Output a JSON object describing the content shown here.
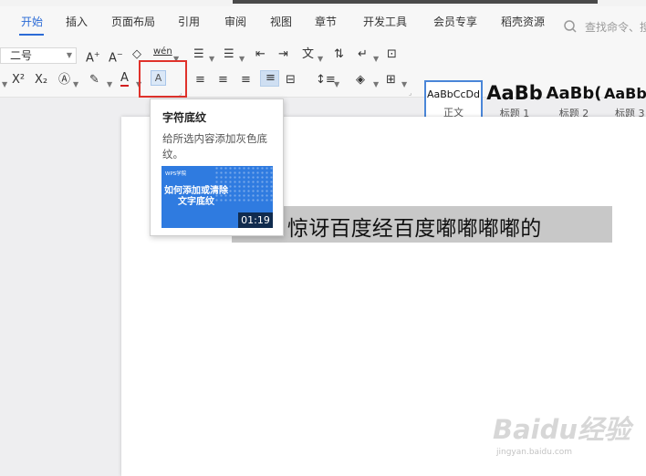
{
  "menu": {
    "tabs": [
      {
        "label": "开始",
        "active": true
      },
      {
        "label": "插入"
      },
      {
        "label": "页面布局"
      },
      {
        "label": "引用"
      },
      {
        "label": "审阅"
      },
      {
        "label": "视图"
      },
      {
        "label": "章节"
      },
      {
        "label": "开发工具"
      },
      {
        "label": "会员专享"
      },
      {
        "label": "稻壳资源"
      }
    ],
    "search_placeholder": "查找命令、搜"
  },
  "ribbon": {
    "font_size": "二号",
    "pinyin_label": "wén",
    "superscript": "X²",
    "subscript": "X₂",
    "font_color_letter": "A",
    "shading_letter": "A"
  },
  "styles": [
    {
      "sample": "AaBbCcDd",
      "name": "正文"
    },
    {
      "sample": "AaBb",
      "name": "标题 1"
    },
    {
      "sample": "AaBb(",
      "name": "标题 2"
    },
    {
      "sample": "AaBb",
      "name": "标题 3"
    }
  ],
  "tooltip": {
    "title": "字符底纹",
    "description": "给所选内容添加灰色底纹。",
    "video_logo": "WPS学院",
    "video_title": "如何添加或清除文字底纹",
    "video_duration": "01:19"
  },
  "document": {
    "selected_text": "惊讶百度经百度嘟嘟嘟嘟的"
  },
  "watermark": {
    "brand": "Baidu经验",
    "url": "jingyan.baidu.com"
  },
  "colors": {
    "accent": "#2b6bd6",
    "highlight_border": "#e0322b",
    "shading": "#c8c8c8"
  }
}
